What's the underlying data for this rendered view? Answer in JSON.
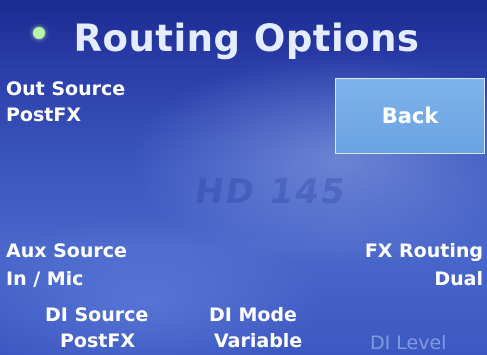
{
  "header": {
    "title": "Routing Options"
  },
  "out_source": {
    "label": "Out Source",
    "value": "PostFX"
  },
  "back_button": {
    "label": "Back"
  },
  "watermark_text": "HD 145",
  "aux_source": {
    "label": "Aux Source",
    "value": "In / Mic"
  },
  "fx_routing": {
    "label": "FX Routing",
    "value": "Dual"
  },
  "di_source": {
    "label": "DI Source",
    "value": "PostFX"
  },
  "di_mode": {
    "label": "DI Mode",
    "value": "Variable"
  },
  "di_level": {
    "label": "DI Level"
  },
  "colors": {
    "background": "#3a55be",
    "button": "#6aa2e2",
    "led": "#b9f5a8"
  }
}
